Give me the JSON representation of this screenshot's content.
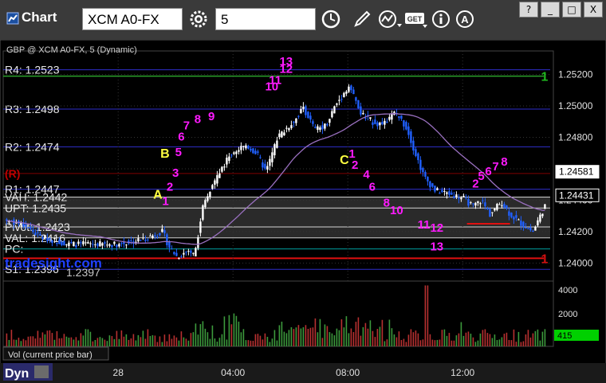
{
  "window": {
    "title": "Chart",
    "symbol": "XCM A0-FX",
    "interval": "5",
    "buttons": {
      "help": "?",
      "minimize": "_",
      "maximize": "□",
      "close": "X"
    }
  },
  "chart_data": {
    "type": "candlestick",
    "title": "GBP @ XCM A0-FX, 5 (Dynamic)",
    "ylim": [
      1.2388,
      1.2535
    ],
    "y_ticks": [
      "1.25200",
      "1.25000",
      "1.24800",
      "1.24600",
      "1.24400",
      "1.24200",
      "1.24000"
    ],
    "x_ticks": [
      "28",
      "04:00",
      "08:00",
      "12:00"
    ],
    "levels": [
      {
        "label": "R4: 1.2523",
        "value": 1.2523,
        "color": "#3a3aff"
      },
      {
        "label": "R3: 1.2498",
        "value": 1.2498,
        "color": "#3a3aff"
      },
      {
        "label": "R2: 1.2474",
        "value": 1.2474,
        "color": "#3a3aff"
      },
      {
        "label": "(R)",
        "value": 1.2457,
        "color": "#a00000"
      },
      {
        "label": "R1: 1.2447",
        "value": 1.2447,
        "color": "#3a3aff"
      },
      {
        "label": "VAH: 1.2442",
        "value": 1.2442,
        "color": "#ffffff"
      },
      {
        "label": "UPT: 1.2435",
        "value": 1.2435,
        "color": "#ffffff"
      },
      {
        "label": "Pivot: 1.2423",
        "value": 1.2423,
        "color": "#ffffff"
      },
      {
        "label": "VAL: 1.2416",
        "value": 1.2416,
        "color": "#ffffff"
      },
      {
        "label": "PC:",
        "value": 1.2409,
        "color": "#00c8c8"
      },
      {
        "label": "S1: 1.2396",
        "value": 1.2396,
        "color": "#3a3aff"
      }
    ],
    "overlay_text": [
      "tradesight.com",
      "1.2397"
    ],
    "price_tags": [
      {
        "label": "1.24581",
        "value": 1.24581,
        "style": "white"
      },
      {
        "label": "1.24431",
        "value": 1.24431,
        "style": "black"
      }
    ],
    "pattern_letters": [
      {
        "t": "A",
        "x": 1.33,
        "y": 1.2441
      },
      {
        "t": "B",
        "x": 1.58,
        "y": 1.2467
      },
      {
        "t": "C",
        "x": 7.83,
        "y": 1.2463
      }
    ],
    "sequence_numbers": [
      {
        "t": "1",
        "x": 1.6,
        "y": 1.2437
      },
      {
        "t": "2",
        "x": 1.75,
        "y": 1.2446
      },
      {
        "t": "3",
        "x": 1.95,
        "y": 1.2455
      },
      {
        "t": "5",
        "x": 2.05,
        "y": 1.2468
      },
      {
        "t": "6",
        "x": 2.15,
        "y": 1.2478
      },
      {
        "t": "7",
        "x": 2.33,
        "y": 1.2485
      },
      {
        "t": "8",
        "x": 2.72,
        "y": 1.2489
      },
      {
        "t": "9",
        "x": 3.2,
        "y": 1.2491
      },
      {
        "t": "10",
        "x": 5.3,
        "y": 1.251
      },
      {
        "t": "11",
        "x": 5.42,
        "y": 1.2514
      },
      {
        "t": "12",
        "x": 5.8,
        "y": 1.2521
      },
      {
        "t": "13",
        "x": 5.8,
        "y": 1.2526
      },
      {
        "t": "1",
        "x": 8.1,
        "y": 1.2467
      },
      {
        "t": "2",
        "x": 8.2,
        "y": 1.246
      },
      {
        "t": "4",
        "x": 8.6,
        "y": 1.2454
      },
      {
        "t": "6",
        "x": 8.8,
        "y": 1.2446
      },
      {
        "t": "8",
        "x": 9.3,
        "y": 1.2436
      },
      {
        "t": "10",
        "x": 9.65,
        "y": 1.2431
      },
      {
        "t": "11",
        "x": 10.6,
        "y": 1.2422
      },
      {
        "t": "12",
        "x": 11.05,
        "y": 1.242
      },
      {
        "t": "13",
        "x": 11.05,
        "y": 1.2408
      },
      {
        "t": "2",
        "x": 12.4,
        "y": 1.2448
      },
      {
        "t": "5",
        "x": 12.6,
        "y": 1.2453
      },
      {
        "t": "6",
        "x": 12.85,
        "y": 1.2456
      },
      {
        "t": "7",
        "x": 13.1,
        "y": 1.2459
      },
      {
        "t": "8",
        "x": 13.4,
        "y": 1.2462
      }
    ],
    "setup_numbers": [
      {
        "t": "1",
        "x": 14.0,
        "y": 1.2519,
        "color": "#1fb81f"
      },
      {
        "t": "1",
        "x": 14.0,
        "y": 1.2403,
        "color": "#d01010"
      }
    ],
    "volume_panel": {
      "label": "Vol (current price bar)",
      "ylim": [
        0,
        4500
      ],
      "ticks": [
        "4000",
        "2000"
      ],
      "last_value": "415"
    },
    "footer": {
      "mode": "Dyn"
    }
  }
}
